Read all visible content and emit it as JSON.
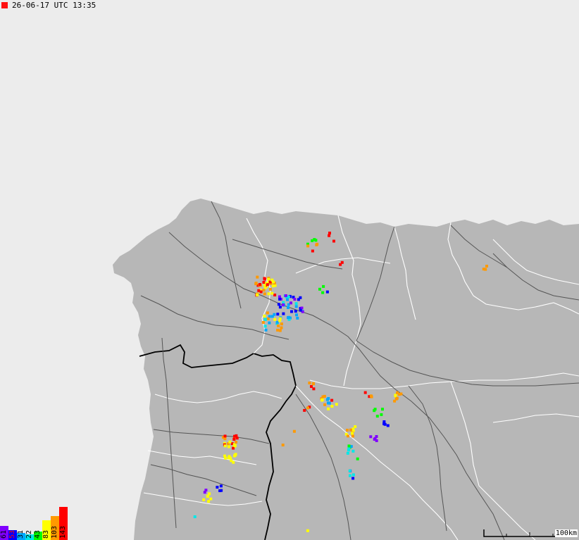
{
  "timestamp": {
    "text": "26-06-17 UTC 13:35",
    "marker_color": "#ff1010"
  },
  "legend": [
    {
      "label": "61",
      "color": "#8000ff"
    },
    {
      "label": "53",
      "color": "#0000ff"
    },
    {
      "label": "31",
      "color": "#00a8ff"
    },
    {
      "label": "22",
      "color": "#00e8e8"
    },
    {
      "label": "43",
      "color": "#00ff00"
    },
    {
      "label": "83",
      "color": "#ffff00"
    },
    {
      "label": "103",
      "color": "#ff9900"
    },
    {
      "label": "143",
      "color": "#ff0000"
    }
  ],
  "scale": {
    "label": "100km"
  },
  "colors": {
    "sea": "#ececec",
    "land": "#b4b4b4",
    "roads": "#555555",
    "borders": "#ffffff",
    "country_border": "#000000"
  }
}
